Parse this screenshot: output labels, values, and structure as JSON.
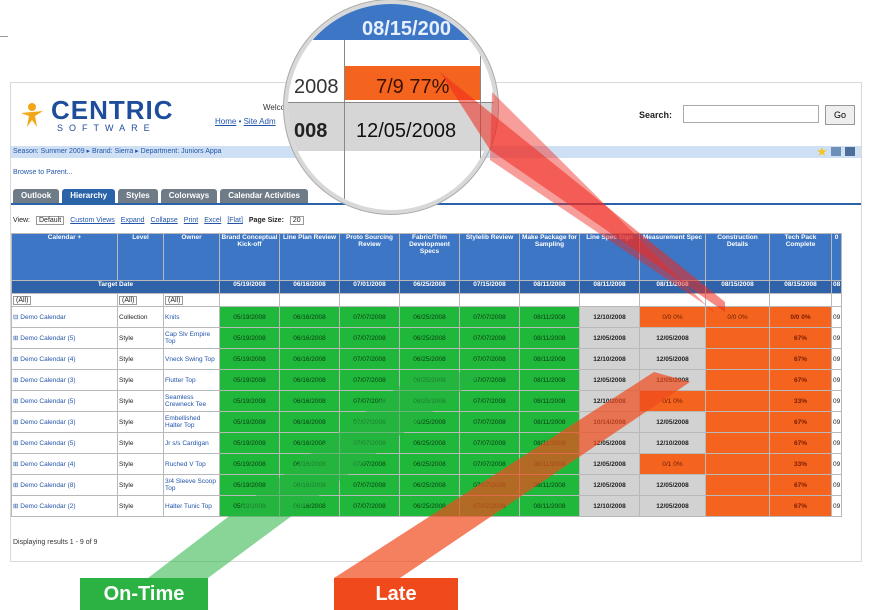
{
  "brand": {
    "name": "CENTRIC",
    "sub": "SOFTWARE"
  },
  "header": {
    "welcome": "Welco",
    "home": "Home",
    "site_admin": "Site Adm",
    "search_label": "Search:",
    "go": "Go"
  },
  "breadcrumb": "Season: Summer 2009 ▸ Brand: Sierra ▸ Department: Juniors Appa",
  "browse_parent": "Browse to Parent...",
  "tabs": [
    "Outlook",
    "Hierarchy",
    "Styles",
    "Colorways",
    "Calendar Activities"
  ],
  "viewbar": {
    "view_label": "View:",
    "view_value": "Default",
    "custom_views": "Custom Views",
    "expand": "Expand",
    "collapse": "Collapse",
    "print": "Print",
    "excel": "Excel",
    "flat": "[Flat]",
    "page_size_label": "Page Size:",
    "page_size": "20"
  },
  "columns": [
    "Calendar +",
    "Level",
    "Owner",
    "Brand Conceptual Kick-off",
    "Line Plan Review",
    "Proto Sourcing Review",
    "Fabric/Trim Development Specs",
    "Stylelib Review",
    "Make Package for Sampling",
    "Line Spec Sign",
    "Measurement Spec",
    "Construction Details",
    "Tech Pack Complete",
    "0"
  ],
  "target_label": "Target Date",
  "target_dates": [
    "05/19/2008",
    "06/16/2008",
    "07/01/2008",
    "06/25/2008",
    "07/15/2008",
    "08/11/2008",
    "08/11/2008",
    "08/11/2008",
    "08/15/2008",
    "08/15/2008",
    "08"
  ],
  "filter": "(All)",
  "rows": [
    {
      "name": "⊟ Demo Calendar",
      "level": "Collection",
      "owner": "Knits",
      "cells": [
        "05/19/2008",
        "06/16/2008",
        "07/07/2008",
        "06/25/2008",
        "07/07/2008",
        "08/11/2008",
        "12/10/2008",
        "0/0 0%",
        "0/0 0%",
        "0/0 0%",
        "09"
      ]
    },
    {
      "name": "⊞ Demo Calendar (5)",
      "level": "Style",
      "owner": "Cap Slv Empire Top",
      "cells": [
        "05/19/2008",
        "06/16/2008",
        "07/07/2008",
        "06/25/2008",
        "07/07/2008",
        "08/11/2008",
        "12/05/2008",
        "12/05/2008",
        "",
        "67%",
        "09"
      ]
    },
    {
      "name": "⊞ Demo Calendar (4)",
      "level": "Style",
      "owner": "Vneck Swing Top",
      "cells": [
        "05/19/2008",
        "06/16/2008",
        "07/07/2008",
        "06/25/2008",
        "07/07/2008",
        "08/11/2008",
        "12/10/2008",
        "12/05/2008",
        "",
        "67%",
        "09"
      ]
    },
    {
      "name": "⊞ Demo Calendar (3)",
      "level": "Style",
      "owner": "Flutter Top",
      "cells": [
        "05/19/2008",
        "06/16/2008",
        "07/07/2008",
        "06/25/2008",
        "07/07/2008",
        "08/11/2008",
        "12/05/2008",
        "12/05/2008",
        "",
        "67%",
        "09"
      ]
    },
    {
      "name": "⊞ Demo Calendar (5)",
      "level": "Style",
      "owner": "Seamless Crewneck Tee",
      "cells": [
        "05/19/2008",
        "06/16/2008",
        "07/07/2008",
        "06/25/2008",
        "07/07/2008",
        "08/11/2008",
        "12/10/2008",
        "0/1 0%",
        "",
        "33%",
        "09"
      ]
    },
    {
      "name": "⊞ Demo Calendar (3)",
      "level": "Style",
      "owner": "Embellished Halter Top",
      "cells": [
        "05/19/2008",
        "06/16/2008",
        "07/07/2008",
        "06/25/2008",
        "07/07/2008",
        "08/11/2008",
        "10/14/2008",
        "12/05/2008",
        "",
        "67%",
        "09"
      ]
    },
    {
      "name": "⊞ Demo Calendar (5)",
      "level": "Style",
      "owner": "Jr s/s Cardigan",
      "cells": [
        "05/19/2008",
        "06/16/2008",
        "07/07/2008",
        "06/25/2008",
        "07/07/2008",
        "08/11/2008",
        "12/05/2008",
        "12/10/2008",
        "",
        "67%",
        "09"
      ]
    },
    {
      "name": "⊞ Demo Calendar (4)",
      "level": "Style",
      "owner": "Ruched V Top",
      "cells": [
        "05/19/2008",
        "06/16/2008",
        "07/07/2008",
        "06/25/2008",
        "07/07/2008",
        "08/11/2008",
        "12/05/2008",
        "0/1 0%",
        "",
        "33%",
        "09"
      ]
    },
    {
      "name": "⊞ Demo Calendar (8)",
      "level": "Style",
      "owner": "3/4 Sleeve Scoop Top",
      "cells": [
        "05/19/2008",
        "06/16/2008",
        "07/07/2008",
        "06/25/2008",
        "07/07/2008",
        "08/11/2008",
        "12/05/2008",
        "12/05/2008",
        "",
        "67%",
        "09"
      ]
    },
    {
      "name": "⊞ Demo Calendar (2)",
      "level": "Style",
      "owner": "Halter Tunic Top",
      "cells": [
        "05/19/2008",
        "06/16/2008",
        "07/07/2008",
        "06/25/2008",
        "07/07/2008",
        "08/11/2008",
        "12/10/2008",
        "12/05/2008",
        "",
        "67%",
        "09"
      ]
    }
  ],
  "footer": "Displaying results 1 - 9 of 9",
  "magnifier": {
    "header_date": "08/15/200",
    "row1_year": "2008",
    "row1_value": "7/9 77%",
    "row2_year": "008",
    "row2_value": "12/05/2008"
  },
  "legend": {
    "on_time": "On-Time",
    "late": "Late"
  },
  "colors": {
    "on_time": "#1fb83a",
    "late": "#f4641e",
    "brand": "#1e4d9b",
    "header": "#3d76c4"
  }
}
